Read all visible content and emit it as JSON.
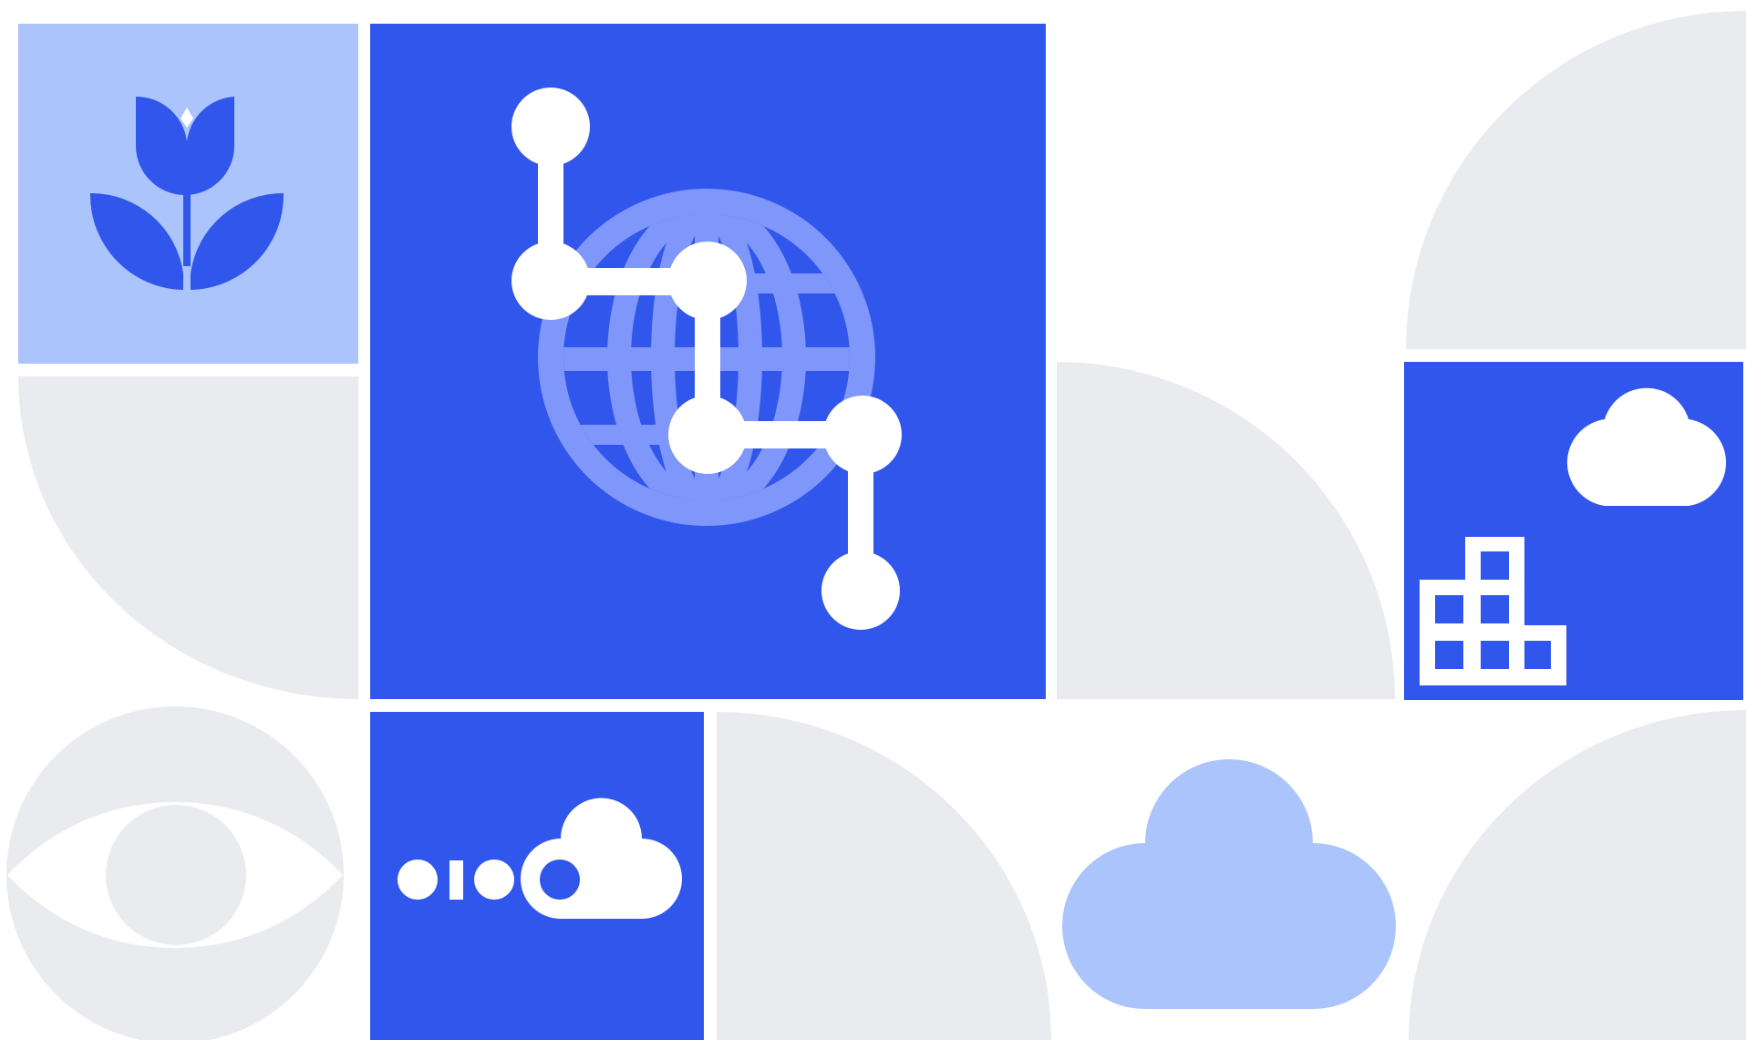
{
  "palette": {
    "background": "#ffffff",
    "primary_blue": "#3156EB",
    "light_blue": "#ABC4FC",
    "globe_blue": "#7F97FA",
    "shape_gray": "#EAEBEF",
    "white": "#ffffff"
  },
  "tiles": [
    {
      "name": "tile-tulip",
      "icon": "tulip-icon",
      "color": "light_blue"
    },
    {
      "name": "tile-globe-network",
      "icon": "globe-network-icon",
      "color": "primary_blue"
    },
    {
      "name": "tile-cloud-building",
      "icon": "cloud-building-icon",
      "color": "primary_blue"
    },
    {
      "name": "tile-cloud-connection",
      "icon": "cloud-connection-icon",
      "color": "primary_blue"
    },
    {
      "name": "shape-cloud-large",
      "icon": "cloud-icon",
      "color": "light_blue"
    },
    {
      "name": "shape-eye",
      "icon": "eye-icon",
      "color": "shape_gray"
    }
  ],
  "decorative_shapes": [
    "quarter-circle",
    "quarter-circle",
    "quarter-circle",
    "quarter-circle",
    "quarter-circle"
  ]
}
